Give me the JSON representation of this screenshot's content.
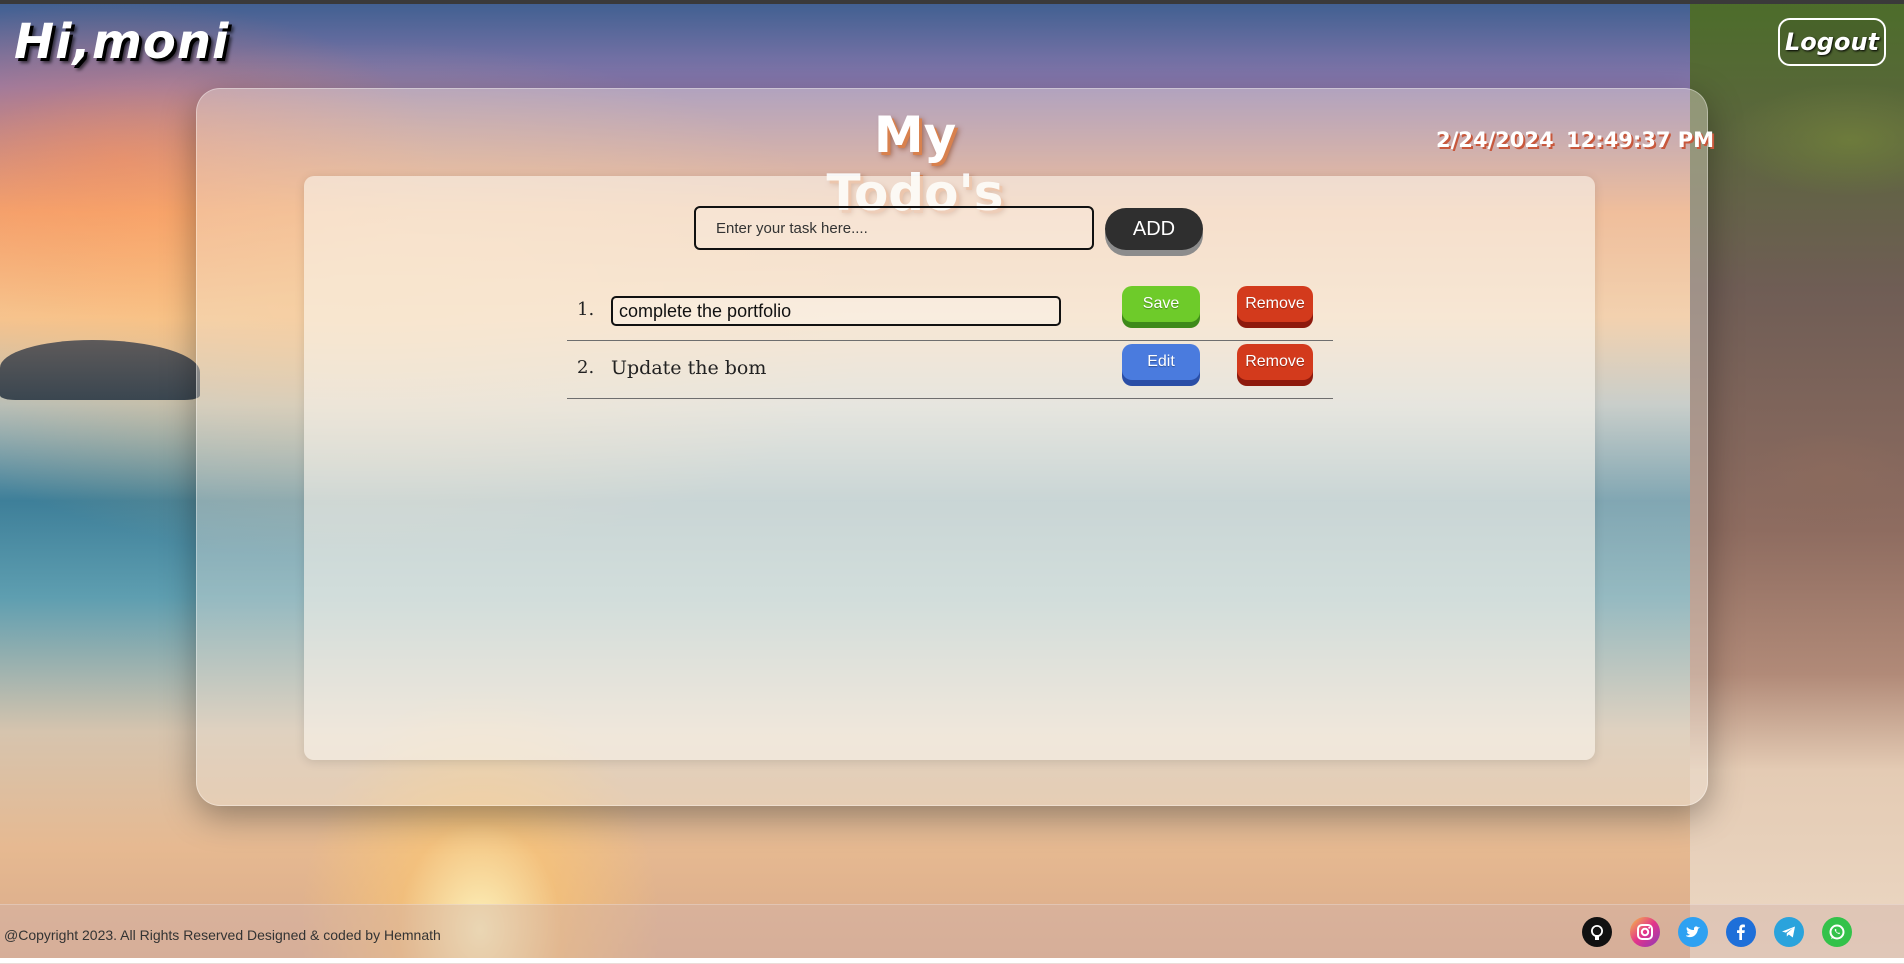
{
  "header": {
    "greeting": "Hi,moni",
    "logout_label": "Logout"
  },
  "main": {
    "title": "My Todo's",
    "date": "2/24/2024",
    "time": "12:49:37 PM",
    "task_input_placeholder": "Enter your task here....",
    "add_label": "ADD"
  },
  "todos": [
    {
      "number": "1.",
      "text": "complete the portfolio",
      "editing": true,
      "action_label": "Save",
      "remove_label": "Remove"
    },
    {
      "number": "2.",
      "text": "Update the bom",
      "editing": false,
      "action_label": "Edit",
      "remove_label": "Remove"
    }
  ],
  "footer": {
    "copyright": "@Copyright 2023. All Rights Reserved Designed & coded by Hemnath",
    "socials": [
      "github-icon",
      "instagram-icon",
      "twitter-icon",
      "facebook-icon",
      "telegram-icon",
      "whatsapp-icon"
    ]
  },
  "colors": {
    "save": "#6ecb2a",
    "edit": "#4a7bde",
    "remove": "#d33a1c",
    "add": "#2f2f2f"
  }
}
